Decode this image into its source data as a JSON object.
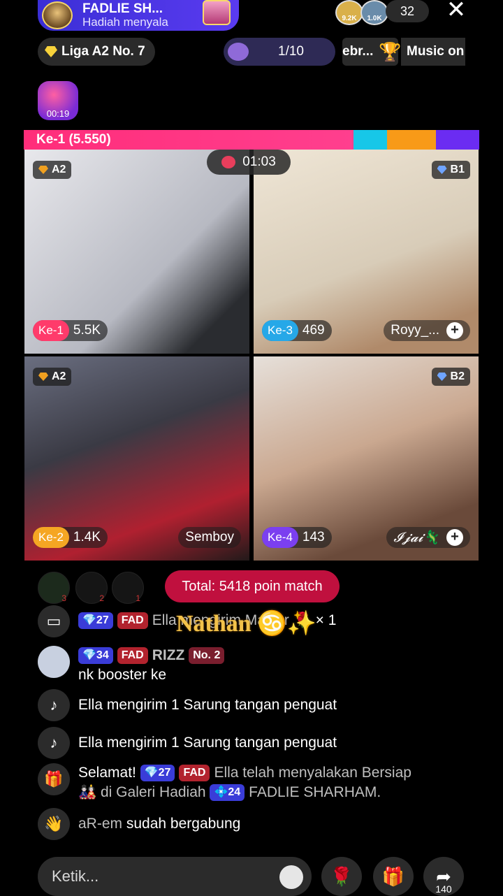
{
  "header": {
    "host_name": "FADLIE SH...",
    "host_subtitle": "Hadiah menyala",
    "viewer_avatar_1": "9.2K",
    "viewer_avatar_2": "1.0K",
    "viewer_count": "32",
    "close_icon": "close-icon"
  },
  "chips": {
    "league": "Liga A2 No. 7",
    "pager": "1/10",
    "event_clip": "ebr...",
    "music": "Music on"
  },
  "promo": {
    "timer": "00:19"
  },
  "match": {
    "rank_label": "Ke-1 (5.550)",
    "timer": "01:03",
    "colors": {
      "pink": "#ff2d7a",
      "cyan": "#17c7e8",
      "orange": "#f89a18",
      "purple": "#6b2cf2"
    }
  },
  "tiles": [
    {
      "badge": "A2",
      "badge_color": "#f0a020",
      "position": "Ke-1",
      "score": "5.5K",
      "username": "",
      "pos_color": "#ff3b6b"
    },
    {
      "badge": "B1",
      "badge_color": "#6fa4ff",
      "position": "Ke-3",
      "score": "469",
      "username": "Royy_...",
      "pos_color": "#26a8e8"
    },
    {
      "badge": "A2",
      "badge_color": "#f0a020",
      "position": "Ke-2",
      "score": "1.4K",
      "username": "Semboy",
      "pos_color": "#f5a623"
    },
    {
      "badge": "B2",
      "badge_color": "#6fa4ff",
      "position": "Ke-4",
      "score": "143",
      "username": "𝓘𝓳𝓪𝓲🦎",
      "pos_color": "#7b3ff0"
    }
  ],
  "supporters": {
    "ranks": [
      "3",
      "2",
      "1"
    ],
    "total": "Total: 5418 poin match"
  },
  "chat": {
    "overlay_name": "Nathan ♋✨",
    "row1": {
      "lvl": "27",
      "fan": "FAD",
      "user": "Ella",
      "text": "mengirim Mawar",
      "gift": "🌹",
      "count": "× 1"
    },
    "row2": {
      "lvl": "34",
      "fan": "FAD",
      "user": "RIZZ",
      "rank": "No. 2",
      "text": "nk booster ke"
    },
    "row3": {
      "text": "Ella mengirim 1 Sarung tangan penguat"
    },
    "row4": {
      "text": "Ella mengirim 1 Sarung tangan penguat"
    },
    "row5": {
      "prefix": "Selamat!",
      "lvl": "27",
      "fan": "FAD",
      "text1": "Ella telah menyalakan Bersiap",
      "text2": "di Galeri Hadiah",
      "lvl2": "24",
      "text3": "FADLIE SHARHAM."
    },
    "row6": {
      "user": "aR-em",
      "text": "sudah bergabung"
    }
  },
  "bottom": {
    "input_placeholder": "Ketik...",
    "share_count": "140"
  }
}
